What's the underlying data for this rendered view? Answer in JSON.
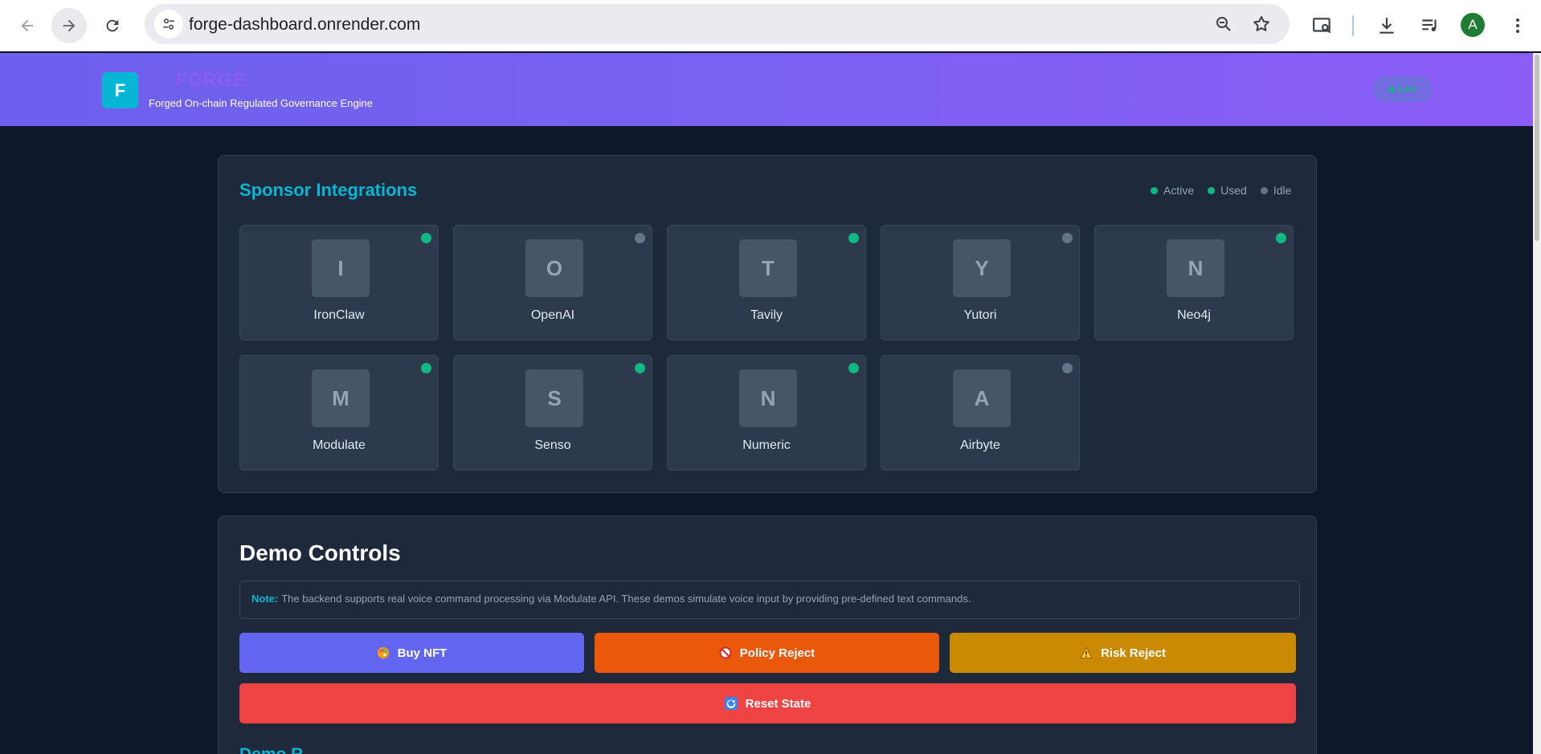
{
  "browser": {
    "url": "forge-dashboard.onrender.com",
    "profile_initial": "A",
    "icons": [
      "back-icon",
      "forward-icon",
      "reload-icon",
      "site-settings-icon",
      "zoom-icon",
      "bookmark-star-icon",
      "screen-search-icon",
      "download-icon",
      "media-controls-icon",
      "menu-icon"
    ]
  },
  "header": {
    "logo_letter": "F",
    "brand": "FORGE",
    "tagline": "Forged On-chain Regulated Governance Engine",
    "status_badge": "Live"
  },
  "sponsors": {
    "title": "Sponsor Integrations",
    "legend": [
      {
        "label": "Active",
        "color": "#10b981"
      },
      {
        "label": "Used",
        "color": "#10b981"
      },
      {
        "label": "Idle",
        "color": "#64748b"
      }
    ],
    "items": [
      {
        "initial": "I",
        "name": "IronClaw",
        "status": "active"
      },
      {
        "initial": "O",
        "name": "OpenAI",
        "status": "idle"
      },
      {
        "initial": "T",
        "name": "Tavily",
        "status": "active"
      },
      {
        "initial": "Y",
        "name": "Yutori",
        "status": "idle"
      },
      {
        "initial": "N",
        "name": "Neo4j",
        "status": "active"
      },
      {
        "initial": "M",
        "name": "Modulate",
        "status": "active"
      },
      {
        "initial": "S",
        "name": "Senso",
        "status": "active"
      },
      {
        "initial": "N",
        "name": "Numeric",
        "status": "active"
      },
      {
        "initial": "A",
        "name": "Airbyte",
        "status": "idle"
      }
    ]
  },
  "demo": {
    "title": "Demo Controls",
    "note_label": "Note:",
    "note_text": "The backend supports real voice command processing via Modulate API. These demos simulate voice input by providing pre-defined text commands.",
    "buttons": {
      "buy_nft": {
        "label": "Buy NFT",
        "icon": "palette-icon",
        "color": "#6366f1"
      },
      "policy_reject": {
        "label": "Policy Reject",
        "icon": "prohibited-icon",
        "color": "#ea580c"
      },
      "risk_reject": {
        "label": "Risk Reject",
        "icon": "warning-icon",
        "color": "#ca8a04"
      },
      "reset_state": {
        "label": "Reset State",
        "icon": "refresh-icon",
        "color": "#ef4444"
      }
    },
    "next_section_title": "Demo R..."
  },
  "colors": {
    "page_bg": "#0f172a",
    "card_bg": "#1e293b",
    "accent_cyan": "#06b6d4",
    "status_active": "#10b981",
    "status_idle": "#64748b"
  }
}
